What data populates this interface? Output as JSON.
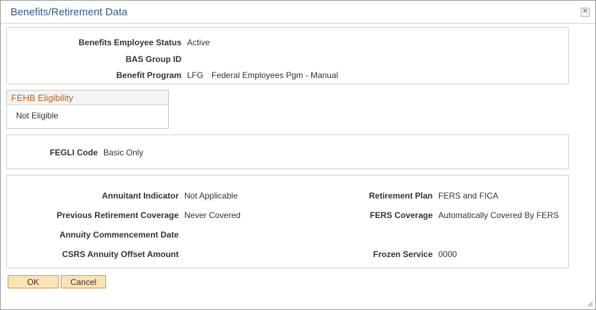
{
  "dialog": {
    "title": "Benefits/Retirement Data",
    "close_icon": "close-icon"
  },
  "benefits": {
    "employee_status_label": "Benefits Employee Status",
    "employee_status_value": "Active",
    "bas_group_label": "BAS Group ID",
    "bas_group_value": "",
    "program_label": "Benefit Program",
    "program_code": "LFG",
    "program_desc": "Federal Employees Pgm - Manual"
  },
  "fehb": {
    "title": "FEHB Eligibility",
    "value": "Not Eligible"
  },
  "fegli": {
    "label": "FEGLI Code",
    "value": "Basic Only"
  },
  "retirement": {
    "annuitant_label": "Annuitant Indicator",
    "annuitant_value": "Not Applicable",
    "prev_coverage_label": "Previous Retirement Coverage",
    "prev_coverage_value": "Never Covered",
    "annuity_date_label": "Annuity Commencement Date",
    "annuity_date_value": "",
    "csrs_offset_label": "CSRS Annuity Offset Amount",
    "csrs_offset_value": "",
    "plan_label": "Retirement Plan",
    "plan_value": "FERS and FICA",
    "fers_label": "FERS Coverage",
    "fers_value": "Automatically Covered By FERS",
    "frozen_label": "Frozen Service",
    "frozen_value": "0000"
  },
  "buttons": {
    "ok": "OK",
    "cancel": "Cancel"
  },
  "colors": {
    "title": "#2d5a8a",
    "group_title": "#b8651f",
    "button_bg": "#fce3b4",
    "button_border": "#c99d57"
  }
}
